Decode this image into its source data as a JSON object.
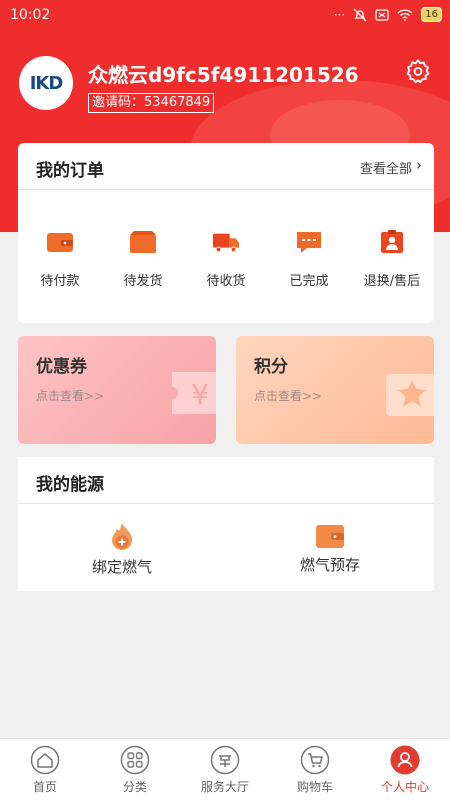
{
  "status_bar": {
    "time": "10:02",
    "indicators": "···",
    "battery": "16"
  },
  "profile": {
    "avatar_text": "IKD",
    "username": "众燃云d9fc5f4911201526",
    "invite_code": "邀请码：53467849"
  },
  "orders": {
    "title": "我的订单",
    "view_all": "查看全部",
    "items": [
      {
        "label": "待付款",
        "icon": "wallet-icon"
      },
      {
        "label": "待发货",
        "icon": "box-icon"
      },
      {
        "label": "待收货",
        "icon": "truck-icon"
      },
      {
        "label": "已完成",
        "icon": "chat-icon"
      },
      {
        "label": "退换/售后",
        "icon": "service-icon"
      }
    ]
  },
  "promos": [
    {
      "title": "优惠券",
      "sub": "点击查看>>",
      "icon": "yen-ticket-icon",
      "color": "#fbb4b6"
    },
    {
      "title": "积分",
      "sub": "点击查看>>",
      "icon": "star-ticket-icon",
      "color": "#ffc8a8"
    }
  ],
  "energy": {
    "title": "我的能源",
    "items": [
      {
        "label": "绑定燃气",
        "icon": "gas-flame-icon"
      },
      {
        "label": "燃气预存",
        "icon": "wallet-icon"
      }
    ]
  },
  "tabbar": {
    "items": [
      {
        "label": "首页",
        "icon": "home-icon"
      },
      {
        "label": "分类",
        "icon": "category-icon"
      },
      {
        "label": "服务大厅",
        "icon": "service-hall-icon"
      },
      {
        "label": "购物车",
        "icon": "cart-icon"
      },
      {
        "label": "个人中心",
        "icon": "profile-icon",
        "active": true
      }
    ]
  },
  "colors": {
    "brand_red": "#ef2d2d",
    "accent_orange": "#f06a2a",
    "active_tab": "#e23b2f"
  }
}
